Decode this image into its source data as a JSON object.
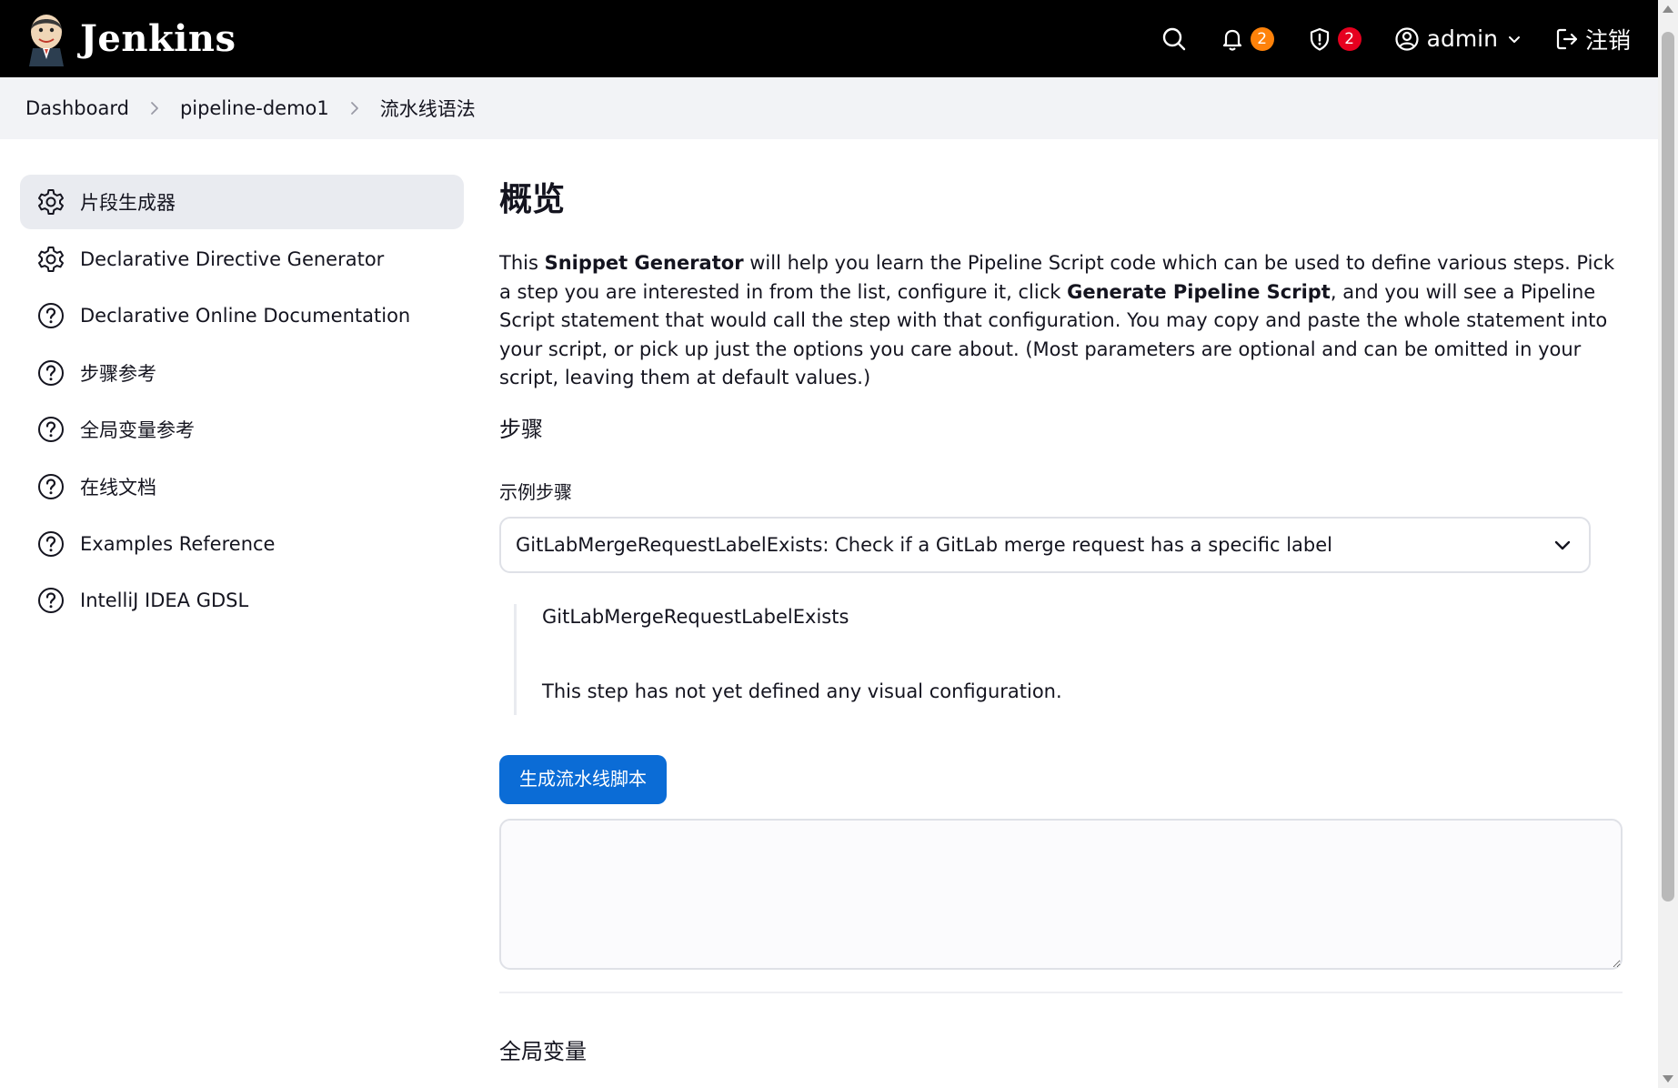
{
  "header": {
    "brand": "Jenkins",
    "notifications_count": "2",
    "security_count": "2",
    "user": "admin",
    "logout": "注销",
    "colors": {
      "bg": "#000000",
      "notif_badge": "#fe820a",
      "security_badge": "#e6001f"
    }
  },
  "breadcrumb": [
    "Dashboard",
    "pipeline-demo1",
    "流水线语法"
  ],
  "sidebar": {
    "items": [
      {
        "label": "片段生成器",
        "icon": "gear-icon",
        "active": true
      },
      {
        "label": "Declarative Directive Generator",
        "icon": "gear-icon"
      },
      {
        "label": "Declarative Online Documentation",
        "icon": "help-icon"
      },
      {
        "label": "步骤参考",
        "icon": "help-icon"
      },
      {
        "label": "全局变量参考",
        "icon": "help-icon"
      },
      {
        "label": "在线文档",
        "icon": "help-icon"
      },
      {
        "label": "Examples Reference",
        "icon": "help-icon"
      },
      {
        "label": "IntelliJ IDEA GDSL",
        "icon": "help-icon"
      }
    ]
  },
  "main": {
    "title": "概览",
    "intro": {
      "p1": "This ",
      "b1": "Snippet Generator",
      "p2": " will help you learn the Pipeline Script code which can be used to define various steps. Pick a step you are interested in from the list, configure it, click ",
      "b2": "Generate Pipeline Script",
      "p3": ", and you will see a Pipeline Script statement that would call the step with that configuration. You may copy and paste the whole statement into your script, or pick up just the options you care about. (Most parameters are optional and can be omitted in your script, leaving them at default values.)"
    },
    "steps_heading": "步骤",
    "sample_step_label": "示例步骤",
    "selected_step": "GitLabMergeRequestLabelExists: Check if a GitLab merge request has a specific label",
    "step_name": "GitLabMergeRequestLabelExists",
    "step_note": "This step has not yet defined any visual configuration.",
    "generate_button": "生成流水线脚本",
    "script_output": "",
    "globals_heading": "全局变量",
    "colors": {
      "button": "#0b6cd6"
    }
  }
}
